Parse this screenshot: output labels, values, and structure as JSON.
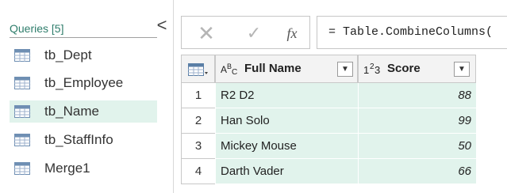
{
  "queries": {
    "title": "Queries [5]",
    "collapse_glyph": "<",
    "items": [
      {
        "label": "tb_Dept",
        "icon": "table-icon"
      },
      {
        "label": "tb_Employee",
        "icon": "table-icon"
      },
      {
        "label": "tb_Name",
        "icon": "table-icon",
        "selected": true
      },
      {
        "label": "tb_StaffInfo",
        "icon": "table-icon"
      },
      {
        "label": "Merge1",
        "icon": "table-icon"
      }
    ]
  },
  "formula_bar": {
    "cancel_glyph": "✕",
    "commit_glyph": "✓",
    "fx_label": "fx",
    "formula": "= Table.CombineColumns("
  },
  "grid": {
    "columns": [
      {
        "type_icon": "ABC",
        "title": "Full Name"
      },
      {
        "type_icon": "123",
        "title": "Score"
      }
    ],
    "rows": [
      {
        "num": "1",
        "name": "R2 D2",
        "score": "88"
      },
      {
        "num": "2",
        "name": "Han Solo",
        "score": "99"
      },
      {
        "num": "3",
        "name": "Mickey Mouse",
        "score": "50"
      },
      {
        "num": "4",
        "name": "Darth Vader",
        "score": "66"
      }
    ]
  },
  "colors": {
    "accent": "#2e7d6b",
    "selected_bg": "#e1f3ec",
    "cell_bg": "#e1f3ec"
  }
}
